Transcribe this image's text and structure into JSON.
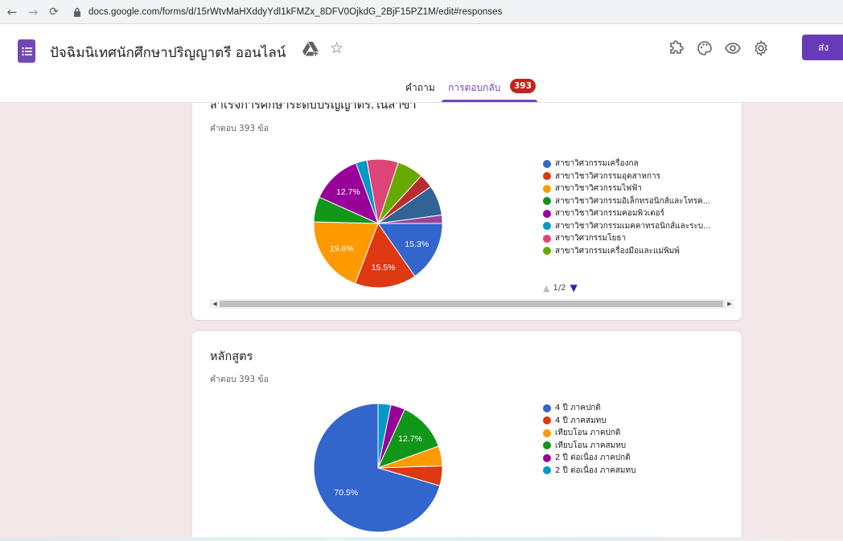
{
  "browser": {
    "url": "docs.google.com/forms/d/15rWtvMaHXddyYdl1kFMZx_8DFV0OjkdG_2BjF15PZ1M/edit#responses"
  },
  "header": {
    "title": "ปัจฉิมนิเทศนักศึกษาปริญญาตรี ออนไลน์",
    "send_label": "ส่ง",
    "tabs": [
      {
        "label": "คำถาม"
      },
      {
        "label": "การตอบกลับ",
        "badge": "393"
      }
    ]
  },
  "colors": {
    "accent": "#673ab7",
    "badge": "#c5221f"
  },
  "cards": [
    {
      "title": "สำเร็จการศึกษาระดับปริญญาตรี.ในสาขา",
      "count_label": "คำตอบ 393 ข้อ",
      "pager": "1/2",
      "chart_data": {
        "type": "pie",
        "legend_visible": [
          "สาขาวิศวกรรมเครื่องกล",
          "สาขาวิชาวิศวกรรมอุตสาหการ",
          "สาขาวิชาวิศวกรรมไฟฟ้า",
          "สาขาวิชาวิศวกรรมอิเล็กทรอนิกส์และโทรค...",
          "สาขาวิชาวิศวกรรมคอมพิวเตอร์",
          "สาขาวิชาวิศวกรรมเมคคาทรอนิกส์และระบ...",
          "สาขาวิศวกรรมโยธา",
          "สาขาวิศวกรรมเครื่องมือและแม่พิมพ์"
        ],
        "slices": [
          {
            "name": "สาขาวิศวกรรมเครื่องกล",
            "value": 15.3,
            "label": "15.3%",
            "color": "#3366cc"
          },
          {
            "name": "สาขาวิชาวิศวกรรมอุตสาหการ",
            "value": 15.5,
            "label": "15.5%",
            "color": "#dc3912"
          },
          {
            "name": "สาขาวิชาวิศวกรรมไฟฟ้า",
            "value": 19.6,
            "label": "19.6%",
            "color": "#ff9900"
          },
          {
            "name": "สาขาวิชาวิศวกรรมอิเล็กทรอนิกส์และโทรค...",
            "value": 6.3,
            "label": "",
            "color": "#109618"
          },
          {
            "name": "สาขาวิชาวิศวกรรมคอมพิวเตอร์",
            "value": 12.7,
            "label": "12.7%",
            "color": "#990099"
          },
          {
            "name": "สาขาวิชาวิศวกรรมเมคคาทรอนิกส์และระบ...",
            "value": 2.8,
            "label": "",
            "color": "#0099c6"
          },
          {
            "name": "สาขาวิศวกรรมโยธา",
            "value": 7.9,
            "label": "",
            "color": "#dd4477"
          },
          {
            "name": "สาขาวิศวกรรมเครื่องมือและแม่พิมพ์",
            "value": 6.6,
            "label": "",
            "color": "#66aa00"
          },
          {
            "name": "",
            "value": 3.6,
            "label": "",
            "color": "#b82e2e"
          },
          {
            "name": "",
            "value": 7.6,
            "label": "",
            "color": "#316395"
          },
          {
            "name": "",
            "value": 2.1,
            "label": "",
            "color": "#994499"
          }
        ]
      }
    },
    {
      "title": "หลักสูตร",
      "count_label": "คำตอบ 393 ข้อ",
      "chart_data": {
        "type": "pie",
        "legend_visible": [
          "4 ปี ภาคปกติ",
          "4 ปี ภาคสมทบ",
          "เทียบโอน ภาคปกติ",
          "เทียบโอน ภาคสมทบ",
          "2 ปี ต่อเนื่อง ภาคปกติ",
          "2 ปี ต่อเนื่อง ภาคสมทบ"
        ],
        "slices": [
          {
            "name": "4 ปี ภาคปกติ",
            "value": 70.5,
            "label": "70.5%",
            "color": "#3366cc"
          },
          {
            "name": "4 ปี ภาคสมทบ",
            "value": 5.0,
            "label": "",
            "color": "#dc3912"
          },
          {
            "name": "เทียบโอน ภาคปกติ",
            "value": 5.0,
            "label": "",
            "color": "#ff9900"
          },
          {
            "name": "เทียบโอน ภาคสมทบ",
            "value": 12.7,
            "label": "12.7%",
            "color": "#109618"
          },
          {
            "name": "2 ปี ต่อเนื่อง ภาคปกติ",
            "value": 3.6,
            "label": "",
            "color": "#990099"
          },
          {
            "name": "2 ปี ต่อเนื่อง ภาคสมทบ",
            "value": 3.2,
            "label": "",
            "color": "#0099c6"
          }
        ]
      }
    }
  ]
}
